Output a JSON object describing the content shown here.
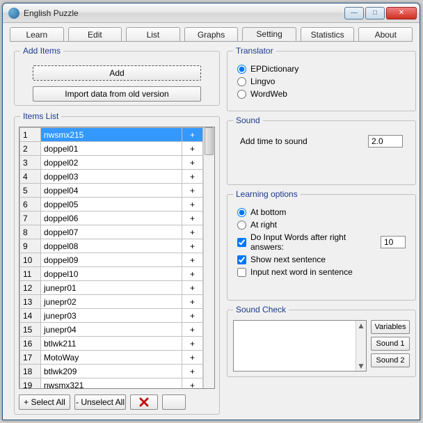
{
  "window": {
    "title": "English Puzzle"
  },
  "tabs": [
    "Learn",
    "Edit",
    "List",
    "Graphs",
    "Setting",
    "Statistics",
    "About"
  ],
  "active_tab": 4,
  "add_items": {
    "legend": "Add Items",
    "add_btn": "Add",
    "import_btn": "Import data from old version"
  },
  "items_list": {
    "legend": "Items List",
    "select_all": "+ Select All",
    "unselect_all": "- Unselect All",
    "rows": [
      {
        "n": "1",
        "name": "nwsmx215",
        "flag": "+",
        "sel": true
      },
      {
        "n": "2",
        "name": "doppel01",
        "flag": "+"
      },
      {
        "n": "3",
        "name": "doppel02",
        "flag": "+"
      },
      {
        "n": "4",
        "name": "doppel03",
        "flag": "+"
      },
      {
        "n": "5",
        "name": "doppel04",
        "flag": "+"
      },
      {
        "n": "6",
        "name": "doppel05",
        "flag": "+"
      },
      {
        "n": "7",
        "name": "doppel06",
        "flag": "+"
      },
      {
        "n": "8",
        "name": "doppel07",
        "flag": "+"
      },
      {
        "n": "9",
        "name": "doppel08",
        "flag": "+"
      },
      {
        "n": "10",
        "name": "doppel09",
        "flag": "+"
      },
      {
        "n": "11",
        "name": "doppel10",
        "flag": "+"
      },
      {
        "n": "12",
        "name": "junepr01",
        "flag": "+"
      },
      {
        "n": "13",
        "name": "junepr02",
        "flag": "+"
      },
      {
        "n": "14",
        "name": "junepr03",
        "flag": "+"
      },
      {
        "n": "15",
        "name": "junepr04",
        "flag": "+"
      },
      {
        "n": "16",
        "name": "btlwk211",
        "flag": "+"
      },
      {
        "n": "17",
        "name": "MotoWay",
        "flag": "+"
      },
      {
        "n": "18",
        "name": "btlwk209",
        "flag": "+"
      },
      {
        "n": "19",
        "name": "nwsmx321",
        "flag": "+"
      }
    ]
  },
  "translator": {
    "legend": "Translator",
    "options": [
      "EPDictionary",
      "Lingvo",
      "WordWeb"
    ],
    "selected": 0
  },
  "sound": {
    "legend": "Sound",
    "label": "Add time to sound",
    "value": "2.0"
  },
  "learning": {
    "legend": "Learning options",
    "pos_options": [
      "At bottom",
      "At right"
    ],
    "pos_selected": 0,
    "do_input_label": "Do Input Words after right answers:",
    "do_input_checked": true,
    "do_input_value": "10",
    "show_next_label": "Show next sentence",
    "show_next_checked": true,
    "input_next_label": "Input next word in sentence",
    "input_next_checked": false
  },
  "sound_check": {
    "legend": "Sound Check",
    "btns": [
      "Variables",
      "Sound 1",
      "Sound 2"
    ]
  }
}
